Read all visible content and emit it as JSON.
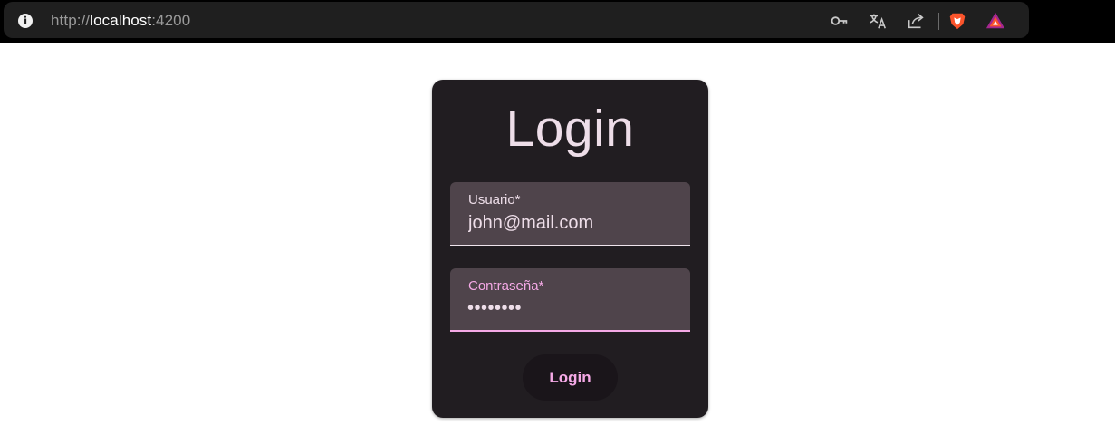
{
  "browser": {
    "url_scheme": "http://",
    "url_host": "localhost",
    "url_port": ":4200",
    "info_icon_glyph": "i",
    "toolbar_icons": [
      "key-icon",
      "translate-icon",
      "share-icon",
      "brave-shields-icon",
      "brave-rewards-icon"
    ],
    "brave_color": "#fb542b"
  },
  "login": {
    "title": "Login",
    "username_label": "Usuario*",
    "username_value": "john@mail.com",
    "password_label": "Contraseña*",
    "password_masked": "••••••••",
    "submit_label": "Login"
  },
  "colors": {
    "card_bg": "#211d21",
    "field_bg": "#4f444b",
    "accent": "#f5a9e6",
    "text": "#eedee9"
  }
}
